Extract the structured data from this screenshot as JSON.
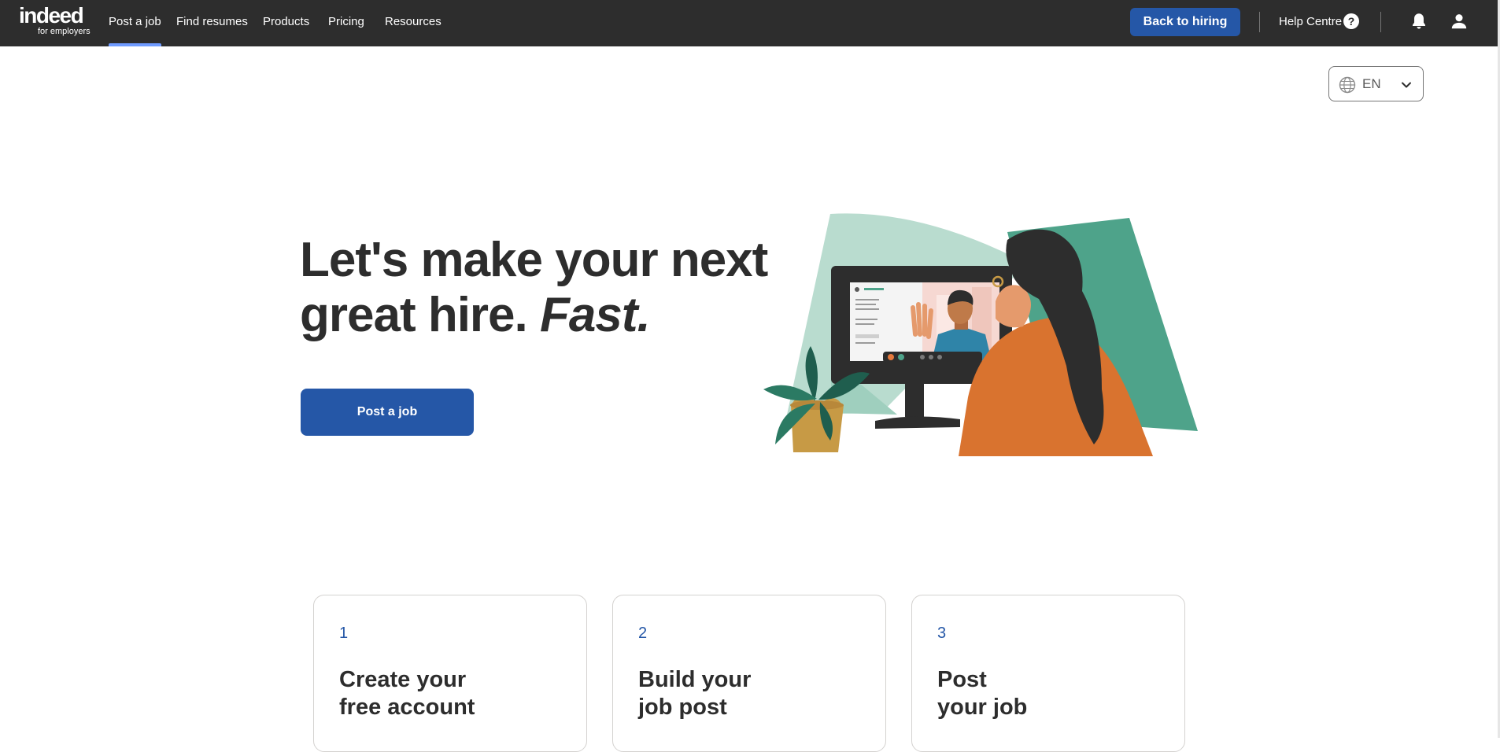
{
  "nav": {
    "logo_word": "indeed",
    "logo_sub": "for employers",
    "links": [
      "Post a job",
      "Find resumes",
      "Products",
      "Pricing",
      "Resources"
    ],
    "back_button": "Back to hiring",
    "help": "Help Centre",
    "help_symbol": "?",
    "icons": [
      "question-icon",
      "bell-icon",
      "user-icon"
    ]
  },
  "language": {
    "code": "EN",
    "icons": [
      "globe-icon",
      "chevron-down-icon"
    ]
  },
  "hero": {
    "line1": "Let's make your next",
    "line2": "great hire.",
    "emphasis": "Fast.",
    "cta": "Post a job"
  },
  "steps": [
    {
      "num": "1",
      "line1": "Create your",
      "line2": "free account"
    },
    {
      "num": "2",
      "line1": "Build your",
      "line2": "job post"
    },
    {
      "num": "3",
      "line1": "Post",
      "line2": "your job"
    }
  ],
  "colors": {
    "nav_bg": "#2d2d2d",
    "primary": "#2557a7",
    "active_underline": "#6f9bff",
    "teal_light": "#b9dccf",
    "teal_dark": "#4ea38a",
    "orange": "#d9732f"
  }
}
